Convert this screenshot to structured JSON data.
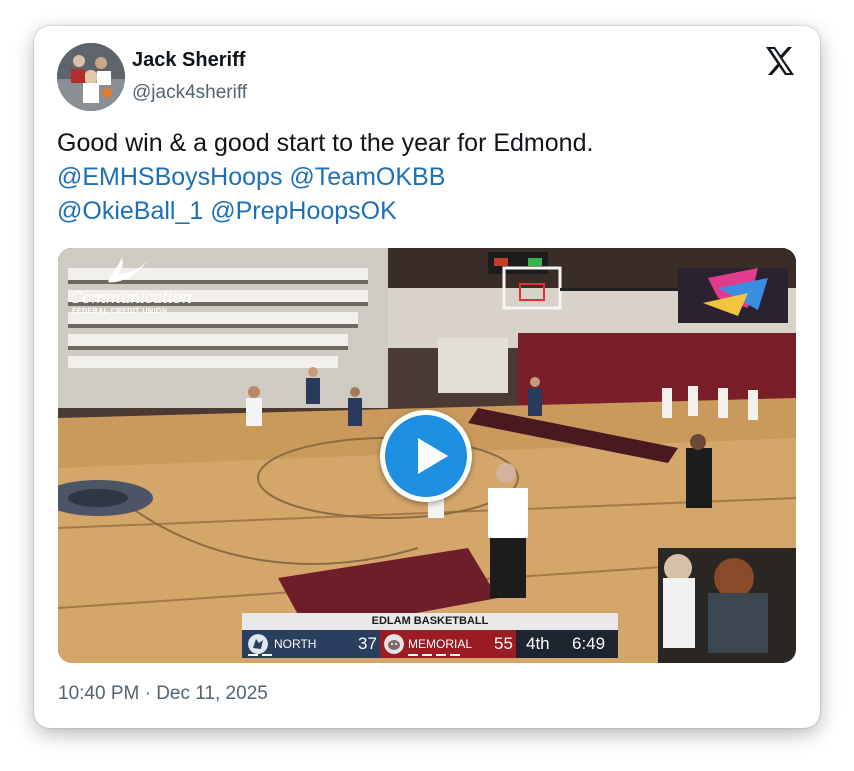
{
  "tweet": {
    "author_name": "Jack Sheriff",
    "author_handle": "@jack4sheriff",
    "text": "Good win & a good start to the year for Edmond.",
    "mentions": [
      "@EMHSBoysHoops",
      "@TeamOKBB",
      "@OkieBall_1",
      "@PrepHoopsOK"
    ],
    "timestamp": "10:40 PM · Dec 11, 2025"
  },
  "video": {
    "sponsor_name": "Communication",
    "sponsor_sub": "FEDERAL CREDIT UNION",
    "scoreboard": {
      "title": "EDLAM BASKETBALL",
      "home_team": "NORTH",
      "home_score": "37",
      "away_team": "MEMORIAL",
      "away_score": "55",
      "period": "4th",
      "clock": "6:49"
    }
  },
  "icons": {
    "brand": "x-logo-icon",
    "play": "play-icon"
  },
  "colors": {
    "link": "#1d6fb8",
    "play_button": "#1d8fe0",
    "home_bar": "#2a3f5f",
    "away_bar": "#9b1c22"
  }
}
